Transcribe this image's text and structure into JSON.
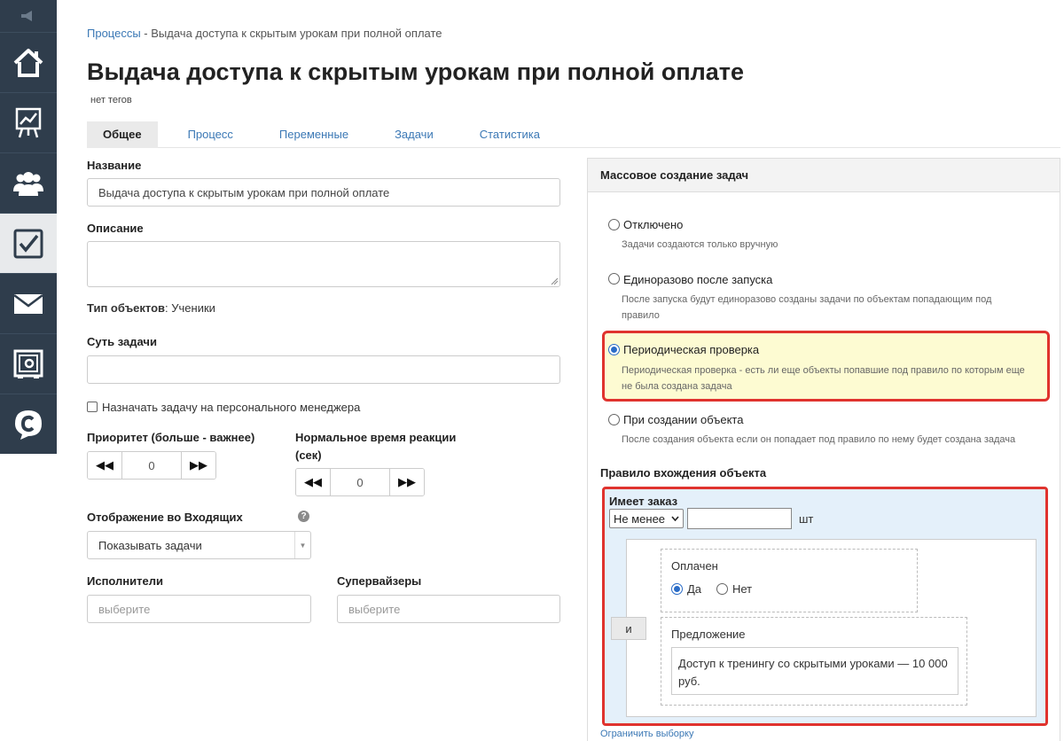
{
  "sidebar": {
    "icons": [
      "megaphone-icon",
      "home-icon",
      "chart-icon",
      "users-icon",
      "tasks-icon",
      "mail-icon",
      "safe-icon",
      "chat-icon"
    ]
  },
  "breadcrumb": {
    "root": "Процессы",
    "separator": " - ",
    "current": "Выдача доступа к скрытым урокам при полной оплате"
  },
  "page": {
    "title": "Выдача доступа к скрытым урокам при полной оплате",
    "tags": "нет тегов"
  },
  "tabs": [
    {
      "label": "Общее",
      "active": true
    },
    {
      "label": "Процесс",
      "active": false
    },
    {
      "label": "Переменные",
      "active": false
    },
    {
      "label": "Задачи",
      "active": false
    },
    {
      "label": "Статистика",
      "active": false
    }
  ],
  "form": {
    "name_label": "Название",
    "name_value": "Выдача доступа к скрытым урокам при полной оплате",
    "description_label": "Описание",
    "object_type_label": "Тип объектов",
    "object_type_value": ": Ученики",
    "essence_label": "Суть задачи",
    "assign_personal_manager": "Назначать задачу на персонального менеджера",
    "priority_label": "Приоритет (больше - важнее)",
    "priority_value": "0",
    "reaction_label_1": "Нормальное время реакции",
    "reaction_label_2": "(сек)",
    "reaction_value": "0",
    "inbox_label": "Отображение во Входящих",
    "inbox_value": "Показывать задачи",
    "executors_label": "Исполнители",
    "executors_placeholder": "выберите",
    "supervisors_label": "Супервайзеры",
    "supervisors_placeholder": "выберите"
  },
  "mass": {
    "title": "Массовое создание задач",
    "options": [
      {
        "label": "Отключено",
        "desc": "Задачи создаются только вручную",
        "selected": false
      },
      {
        "label": "Единоразово после запуска",
        "desc1": "После запуска будут единоразово созданы задачи по объектам попадающим под",
        "desc2": "правило",
        "selected": false
      },
      {
        "label": "Периодическая проверка",
        "desc1": "Периодическая проверка - есть ли еще объекты попавшие под правило по которым еще",
        "desc2": "не была создана задача",
        "selected": true
      },
      {
        "label": "При создании объекта",
        "desc": "После создания объекта если он попадает под правило по нему будет создана задача",
        "selected": false
      }
    ]
  },
  "rule": {
    "title": "Правило вхождения объекта",
    "has_order": "Имеет заказ",
    "comparator": "Не менее",
    "unit": "шт",
    "and_label": "и",
    "paid_label": "Оплачен",
    "paid_yes": "Да",
    "paid_no": "Нет",
    "offer_label": "Предложение",
    "offer_line1": "Доступ к тренингу со скрытыми уроками — 10 000",
    "offer_line2": "руб.",
    "limit_link": "Ограничить выборку"
  },
  "colors": {
    "sidebar_bg": "#2f3d4c",
    "link": "#3b78b5",
    "highlight_border": "#e0332e",
    "highlight_bg": "#fdfbd2",
    "rule_bg": "#e4f0fa"
  }
}
